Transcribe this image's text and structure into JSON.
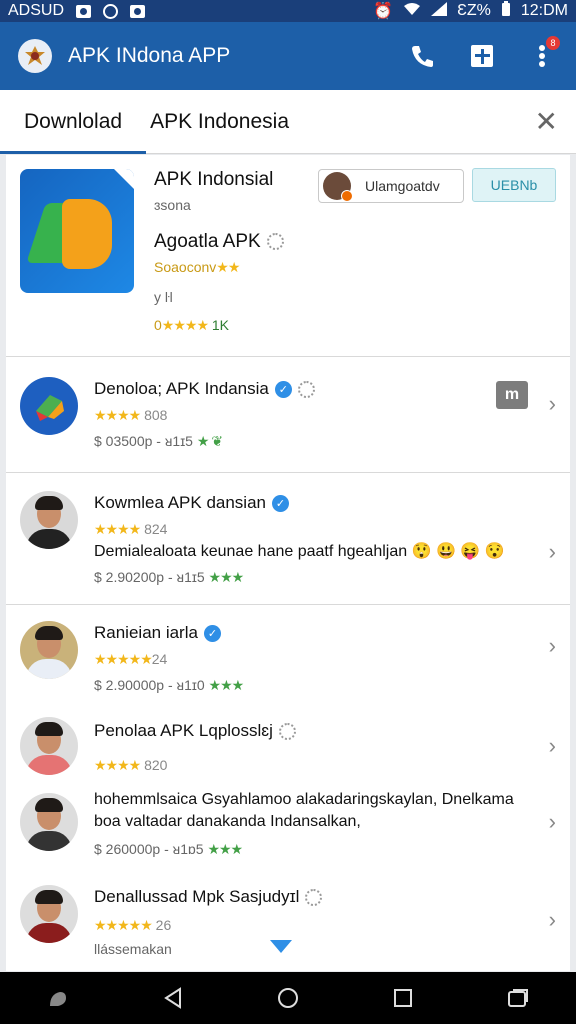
{
  "status": {
    "carrier": "ADSUD",
    "battery": "ƐZ%",
    "time": "12:DM"
  },
  "appbar": {
    "title": "APK INdona APP",
    "notification_count": "8"
  },
  "tabs": [
    {
      "label": "Downlolad"
    },
    {
      "label": "APK Indonesia"
    }
  ],
  "featured": {
    "title": "APK Indonsial",
    "subtitle": "ɜsona",
    "name": "Agoatla APK",
    "rating_text": "Soaoconv",
    "rating_stars": "★★",
    "meta": "y ŀl",
    "count_prefix": "0",
    "count_stars": "★★★★",
    "count_text": "1K",
    "chip_label": "Ulamgoatdv",
    "verify_label": "UEBNb"
  },
  "rows": [
    {
      "title": "Denoloa; APK Indansia",
      "stars": "★★★★",
      "rating": "808",
      "price": "$ 03500p - ᴚ1ɪ5",
      "price_tail": "★ ❦"
    },
    {
      "title": "Kowmlea APK dansian",
      "stars": "★★★★",
      "rating": "824",
      "desc": "Demialealoata keunae hane paatf hgeahljan",
      "emoji": "😲 😃 😝 😯",
      "price": "$ 2.90200p - ᴚ1ɪ5",
      "price_tail": "★★★"
    },
    {
      "title": "Ranieian iarla",
      "stars": "★★★★★",
      "rating": "24",
      "price": "$ 2.90000p - ᴚ1ɪ0",
      "price_tail": "★★★"
    },
    {
      "title": "Penolaa APK Lqplosslɛj",
      "stars": "★★★★",
      "rating": "820"
    },
    {
      "desc1": "hohemmlsaica Gsyahlamoo alakadaringskaylan, Dnelkama",
      "desc2": "boa valtadar danakanda Indansalkan,",
      "price": "$ 260000p - ᴚ1ɒ5",
      "price_tail": "★★★"
    },
    {
      "title": "Denallussad Mpk Sasjudyɪl",
      "stars": "★★★★★",
      "rating": "26",
      "sub": "llássemakan"
    }
  ]
}
